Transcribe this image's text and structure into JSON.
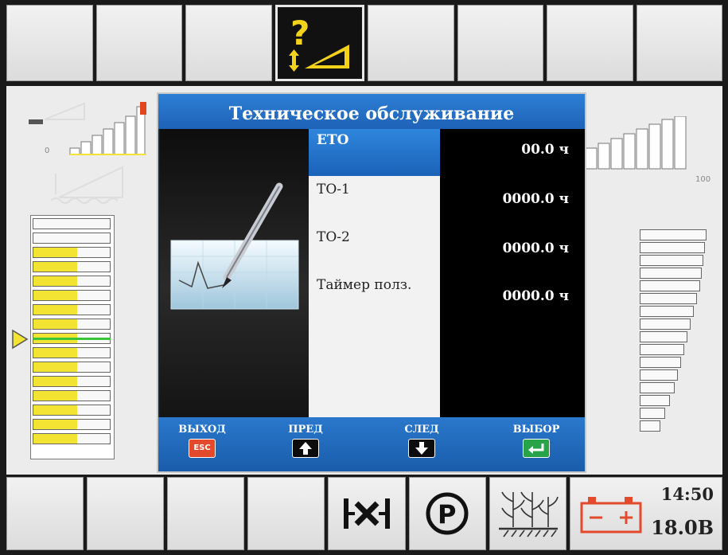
{
  "dialog": {
    "title": "Техническое обслуживание",
    "items": [
      {
        "name": "ЕТО",
        "value": "00.0 ч",
        "selected": true
      },
      {
        "name": "ТО-1",
        "value": "0000.0 ч",
        "selected": false
      },
      {
        "name": "ТО-2",
        "value": "0000.0 ч",
        "selected": false
      },
      {
        "name": "Таймер полз.",
        "value": "0000.0 ч",
        "selected": false
      }
    ],
    "footer": {
      "exit_label": "ВЫХОД",
      "exit_key": "ESC",
      "prev_label": "ПРЕД",
      "next_label": "СЛЕД",
      "select_label": "ВЫБОР"
    }
  },
  "gauges": {
    "left_min": "0",
    "right_max": "100"
  },
  "status": {
    "time": "14:50",
    "voltage": "18.0В"
  },
  "icons": {
    "top_active": "maintenance-help-icon",
    "bottom": [
      "diff-lock-icon",
      "parking-brake-icon",
      "crop-ground-icon",
      "battery-icon"
    ]
  },
  "colors": {
    "accent_blue": "#1e62b6",
    "gauge_yellow": "#f3e332",
    "active_border": "#e8e8e8",
    "battery_red": "#e34a2c",
    "ok_green": "#27a34a"
  }
}
